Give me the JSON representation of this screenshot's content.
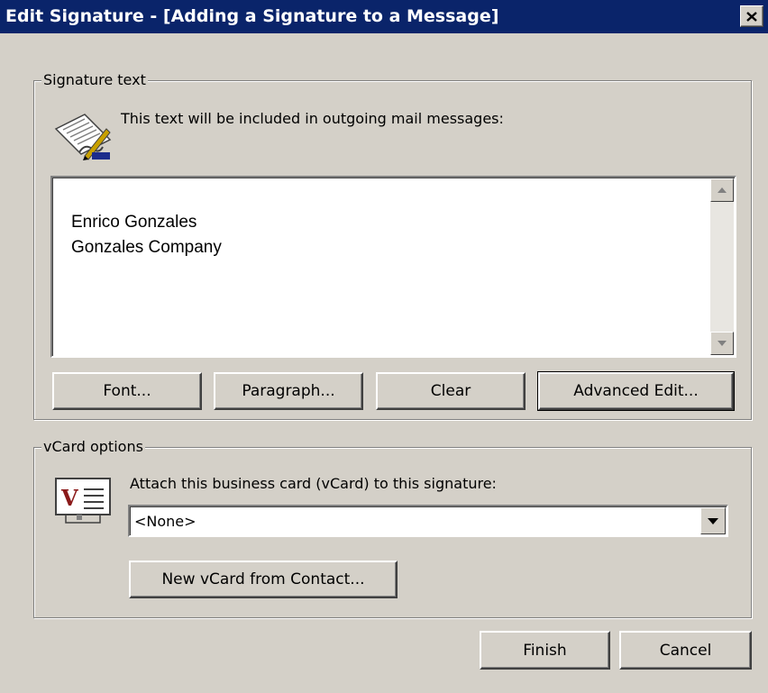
{
  "window": {
    "title": "Edit Signature - [Adding a Signature to a Message]",
    "close_glyph": "✕"
  },
  "signature_group": {
    "legend": "Signature text",
    "instruction": "This text will be included in outgoing mail messages:",
    "text": "Enrico Gonzales\nGonzales Company",
    "buttons": {
      "font": "Font...",
      "paragraph": "Paragraph...",
      "clear": "Clear",
      "advanced_edit": "Advanced Edit..."
    }
  },
  "vcard_group": {
    "legend": "vCard options",
    "instruction": "Attach this business card (vCard) to this signature:",
    "selected": "<None>",
    "new_vcard_button": "New vCard from Contact..."
  },
  "footer": {
    "finish": "Finish",
    "cancel": "Cancel"
  },
  "icons": {
    "signature": "signature-pen-icon",
    "vcard": "vcard-icon"
  },
  "colors": {
    "titlebar": "#0a246a",
    "face": "#d4d0c8"
  }
}
